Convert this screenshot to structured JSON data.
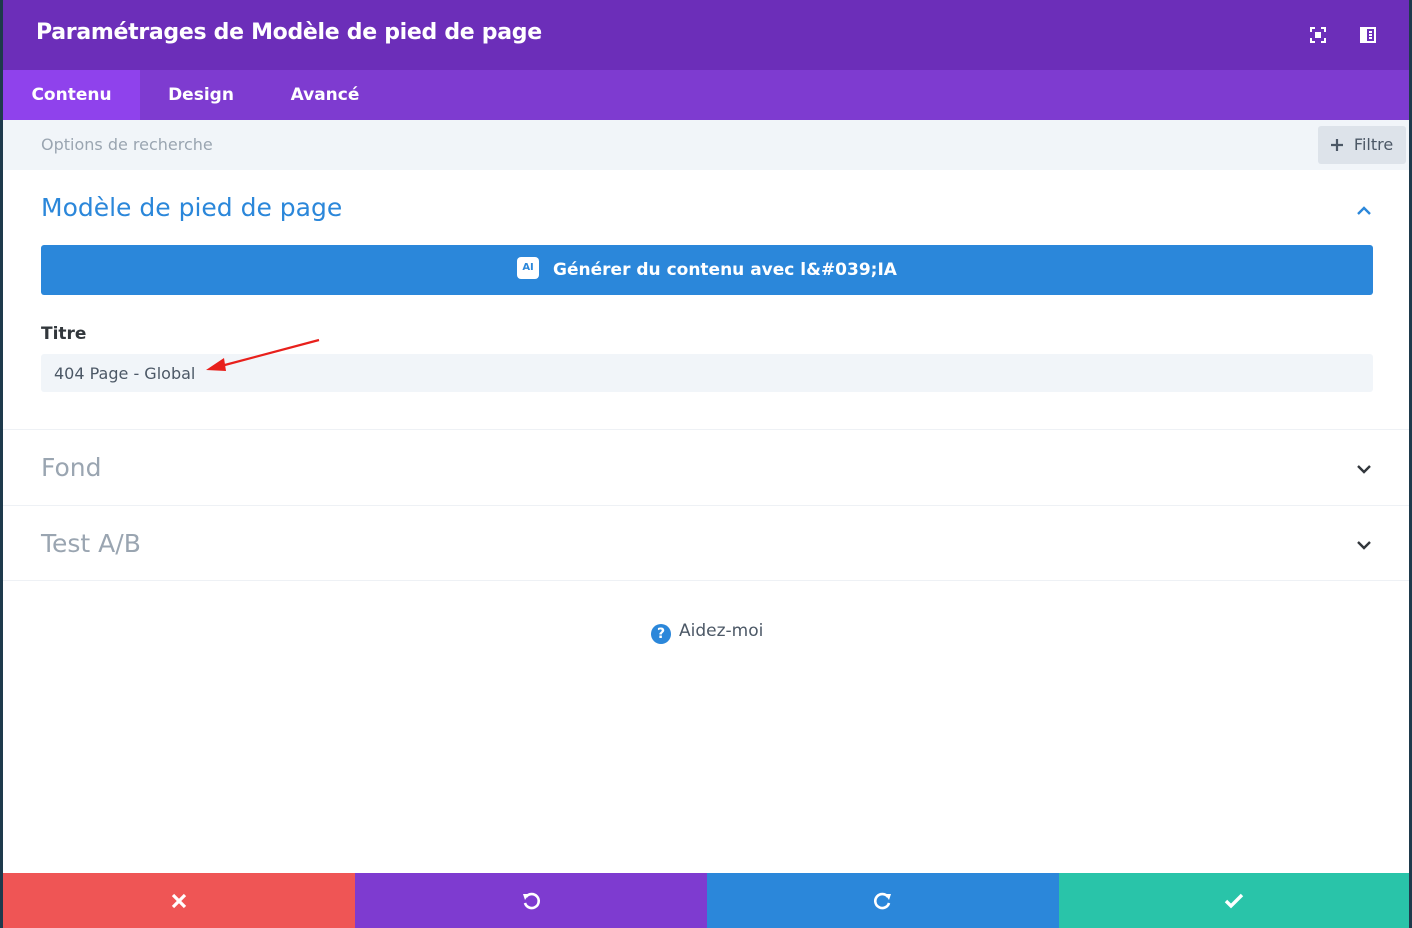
{
  "header": {
    "title": "Paramétrages de Modèle de pied de page",
    "icons": [
      "fullscreen-icon",
      "sidebar-toggle-icon"
    ]
  },
  "tabs": [
    {
      "label": "Contenu",
      "active": true
    },
    {
      "label": "Design",
      "active": false
    },
    {
      "label": "Avancé",
      "active": false
    }
  ],
  "search": {
    "placeholder": "Options de recherche",
    "filter_label": "Filtre"
  },
  "sections": {
    "footer_template": {
      "title": "Modèle de pied de page",
      "expanded": true,
      "ai_badge": "AI",
      "ai_button_label": "Générer du contenu avec l&#039;IA",
      "field_label": "Titre",
      "field_value": "404 Page - Global"
    },
    "background": {
      "title": "Fond",
      "expanded": false
    },
    "ab_test": {
      "title": "Test A/B",
      "expanded": false
    }
  },
  "help": {
    "label": "Aidez-moi"
  },
  "footer": {
    "buttons": [
      {
        "name": "cancel",
        "icon": "close-icon",
        "color": "#ef5555"
      },
      {
        "name": "undo",
        "icon": "undo-icon",
        "color": "#7e3bd0"
      },
      {
        "name": "redo",
        "icon": "redo-icon",
        "color": "#2b87da"
      },
      {
        "name": "save",
        "icon": "check-icon",
        "color": "#29c4a9"
      }
    ]
  },
  "colors": {
    "header": "#6c2eb9",
    "tabs": "#7e3bd0",
    "active_tab": "#8f42ec",
    "accent_blue": "#2b87da",
    "annotation_arrow": "#e8201c"
  }
}
